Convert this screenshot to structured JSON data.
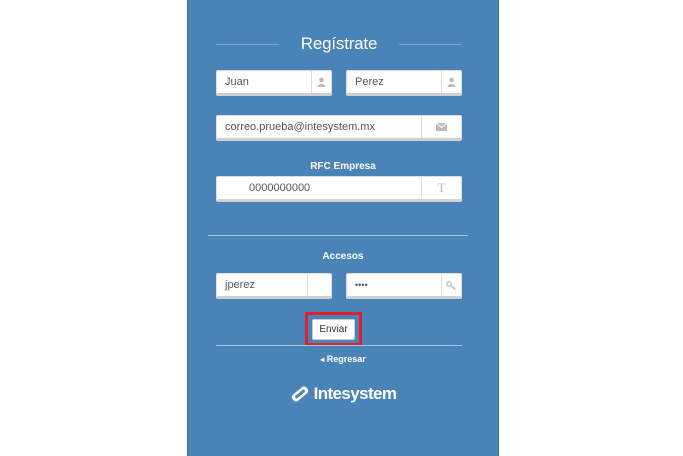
{
  "form": {
    "title": "Regístrate",
    "first_name": "Juan",
    "last_name": "Perez",
    "email": "correo.prueba@intesystem.mx",
    "rfc_label": "RFC Empresa",
    "rfc_value": "0000000000",
    "access_label": "Accesos",
    "username": "jperez",
    "password": "••••",
    "submit_label": "Enviar",
    "back_label": "Regresar"
  },
  "brand": {
    "name": "Intesystem"
  },
  "colors": {
    "panel": "#4a83b7",
    "highlight": "#e0202a"
  }
}
